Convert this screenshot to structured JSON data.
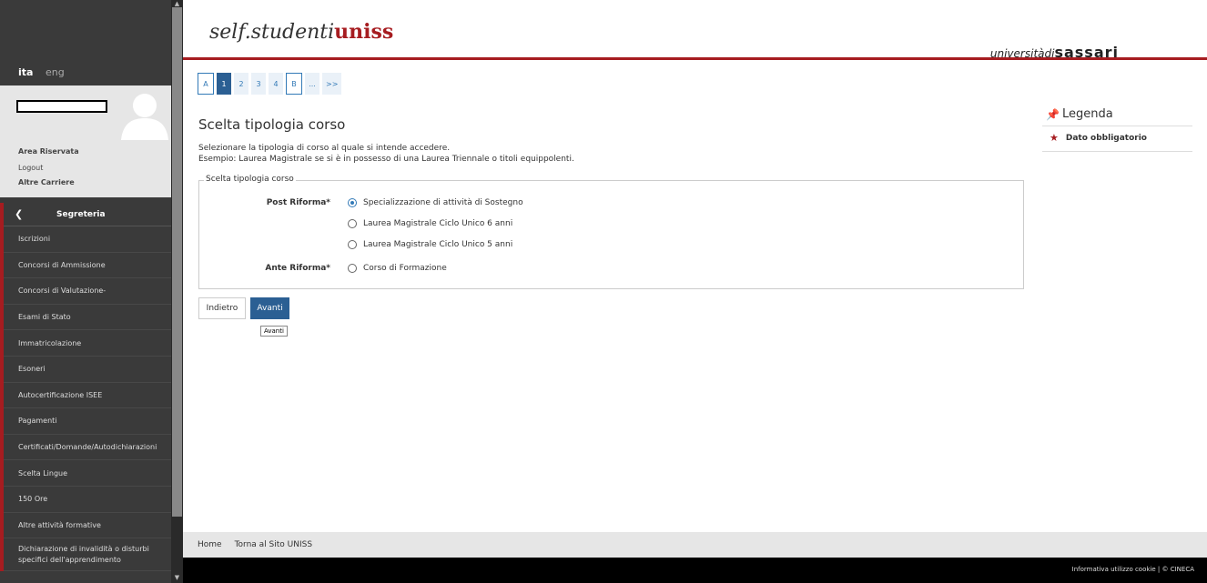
{
  "header": {
    "logo_main": "self.studenti",
    "logo_accent": "uniss",
    "university_prefix": "universitàdi",
    "university_name": "sassari"
  },
  "sidebar": {
    "lang_active": "ita",
    "lang_other": "eng",
    "user_links": [
      "Area Riservata",
      "Logout",
      "Altre Carriere"
    ],
    "menu_title": "Segreteria",
    "menu_items": [
      "Iscrizioni",
      "Concorsi di Ammissione",
      "Concorsi di Valutazione-",
      "Esami di Stato",
      "Immatricolazione",
      "Esoneri",
      "Autocertificazione ISEE",
      "Pagamenti",
      "Certificati/Domande/Autodichiarazioni",
      "Scelta Lingue",
      "150 Ore",
      "Altre attività formative"
    ],
    "menu_item_last_line1": "Dichiarazione di invalidità o disturbi",
    "menu_item_last_line2": "specifici dell'apprendimento"
  },
  "steps": [
    "A",
    "1",
    "2",
    "3",
    "4",
    "B",
    "...",
    ">>"
  ],
  "main": {
    "title": "Scelta tipologia corso",
    "desc_line1": "Selezionare la tipologia di corso al quale si intende accedere.",
    "desc_line2": "Esempio: Laurea Magistrale se si è in possesso di una Laurea Triennale o titoli equippolenti.",
    "fieldset_legend": "Scelta tipologia corso",
    "group_post": "Post Riforma*",
    "group_ante": "Ante Riforma*",
    "options": [
      "Specializzazione di attività di Sostegno",
      "Laurea Magistrale Ciclo Unico 6 anni",
      "Laurea Magistrale Ciclo Unico 5 anni",
      "Corso di Formazione"
    ],
    "selected_option": "Specializzazione di attività di Sostegno",
    "back_label": "Indietro",
    "next_label": "Avanti",
    "tooltip": "Avanti"
  },
  "legenda": {
    "title": "Legenda",
    "item": "Dato obbligatorio"
  },
  "footer": {
    "home": "Home",
    "back_site": "Torna al Sito UNISS",
    "cookies": "Informativa utilizzo cookie | © CINECA"
  },
  "colors": {
    "brand_red": "#a61c20",
    "active_blue": "#2b5f93",
    "link_blue": "#337ab7"
  }
}
